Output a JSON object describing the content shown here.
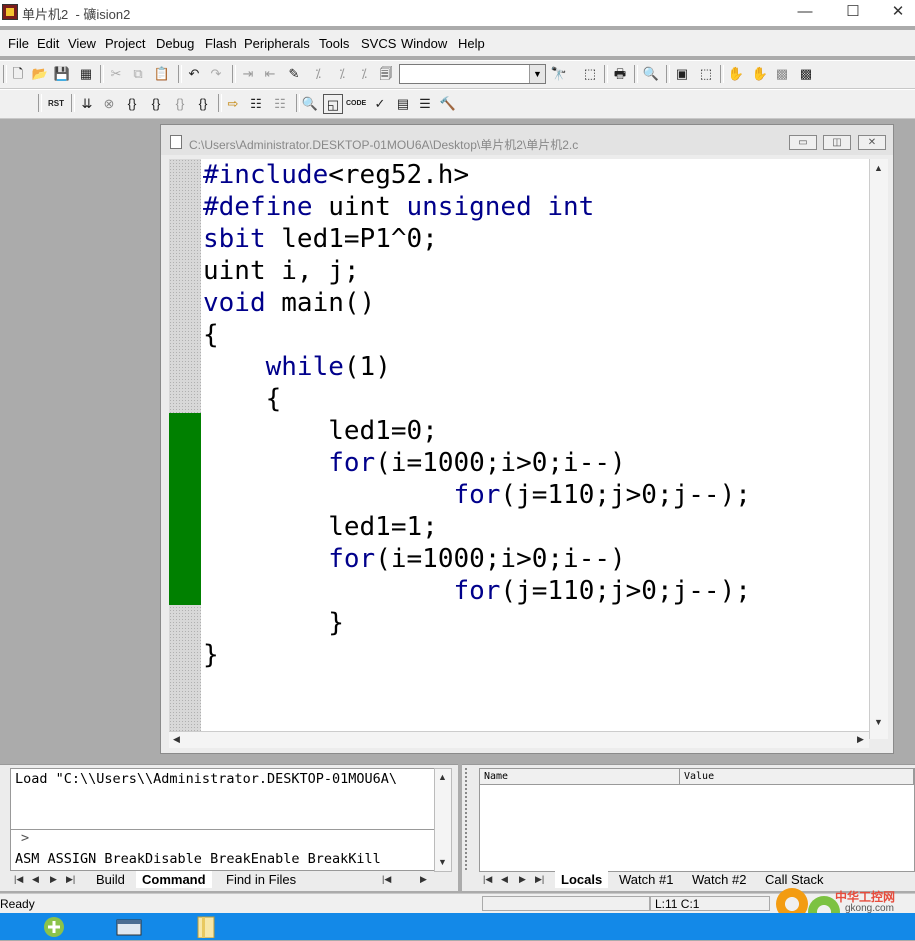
{
  "window": {
    "title": "单片机2  - 礦ision2",
    "minimize_glyph": "—",
    "maximize_glyph": "☐",
    "close_glyph": "✕"
  },
  "menu": [
    "File",
    "Edit",
    "View",
    "Project",
    "Debug",
    "Flash",
    "Peripherals",
    "Tools",
    "SVCS",
    "Window",
    "Help"
  ],
  "toolbar1": {
    "icons": [
      "new-file-icon",
      "open-folder-icon",
      "save-icon",
      "save-all-icon",
      "cut-icon",
      "copy-icon",
      "paste-icon",
      "undo-icon",
      "redo-icon",
      "indent-icon",
      "unindent-icon",
      "bookmark-icon",
      "next-bookmark-icon",
      "prev-bookmark-icon",
      "clear-bookmarks-icon",
      "find-combo",
      "find-icon",
      "find-in-files-icon",
      "print-icon",
      "debug-start-icon",
      "window-icon",
      "browse-icon",
      "hand-icon",
      "hand-stop-icon",
      "grid-icon",
      "options-icon"
    ],
    "glyphs": [
      "🗋",
      "📂",
      "💾",
      "▦",
      "✂",
      "⧉",
      "📋",
      "↶",
      "↷",
      "⇥",
      "⇤",
      "✎",
      "⁒",
      "⁒",
      "⁒",
      "",
      "🔭",
      "🗐",
      "🖶",
      "🔍",
      "▣",
      "⬚",
      "✋",
      "✋",
      "▩",
      "▩"
    ],
    "find_value": ""
  },
  "toolbar2": {
    "icons": [
      "reset-icon",
      "run-icon",
      "stop-icon",
      "step-into-icon",
      "step-over-icon",
      "step-out-icon",
      "run-to-cursor-icon",
      "show-next-icon",
      "enable-bp-icon",
      "disable-bp-icon",
      "disasm-icon",
      "watch-icon",
      "code-coverage-icon",
      "trace-icon",
      "memory-icon",
      "perf-icon",
      "toolbox-icon"
    ],
    "glyphs": [
      "RST",
      "⇊",
      "⊗",
      "{}",
      "{}",
      "{}",
      "{}",
      "⇨",
      "☷",
      "☷",
      "🔍",
      "◱",
      "CODE",
      "✓",
      "▤",
      "☰",
      "🔨"
    ]
  },
  "editor": {
    "title": "C:\\Users\\Administrator.DESKTOP-01MOU6A\\Desktop\\单片机2\\单片机2.c",
    "lines": [
      [
        {
          "t": "#include",
          "k": true
        },
        {
          "t": "<reg52.h>",
          "k": false
        }
      ],
      [
        {
          "t": "#define",
          "k": true
        },
        {
          "t": " uint ",
          "k": false
        },
        {
          "t": "unsigned int",
          "k": true
        }
      ],
      [
        {
          "t": "sbit",
          "k": true
        },
        {
          "t": " led1=P1^0;",
          "k": false
        }
      ],
      [
        {
          "t": "uint i, j;",
          "k": false
        }
      ],
      [
        {
          "t": "void",
          "k": true
        },
        {
          "t": " main()",
          "k": false
        }
      ],
      [
        {
          "t": "{",
          "k": false
        }
      ],
      [
        {
          "t": "    ",
          "k": false
        },
        {
          "t": "while",
          "k": true
        },
        {
          "t": "(1)",
          "k": false
        }
      ],
      [
        {
          "t": "    {",
          "k": false
        }
      ],
      [
        {
          "t": "        led1=0;",
          "k": false
        }
      ],
      [
        {
          "t": "        ",
          "k": false
        },
        {
          "t": "for",
          "k": true
        },
        {
          "t": "(i=1000;i>0;i--)",
          "k": false
        }
      ],
      [
        {
          "t": "                ",
          "k": false
        },
        {
          "t": "for",
          "k": true
        },
        {
          "t": "(j=110;j>0;j--);",
          "k": false
        }
      ],
      [
        {
          "t": "        led1=1;",
          "k": false
        }
      ],
      [
        {
          "t": "        ",
          "k": false
        },
        {
          "t": "for",
          "k": true
        },
        {
          "t": "(i=1000;i>0;i--)",
          "k": false
        }
      ],
      [
        {
          "t": "                ",
          "k": false
        },
        {
          "t": "for",
          "k": true
        },
        {
          "t": "(j=110;j>0;j--);",
          "k": false
        }
      ],
      [
        {
          "t": "        }",
          "k": false
        }
      ],
      [
        {
          "t": "}",
          "k": false
        }
      ]
    ]
  },
  "output": {
    "text": "Load \"C:\\\\Users\\\\Administrator.DESKTOP-01MOU6A\\",
    "prompt": ">",
    "commands": "ASM ASSIGN BreakDisable BreakEnable BreakKill",
    "tabs": [
      "Build",
      "Command",
      "Find in Files"
    ],
    "active_tab": "Command"
  },
  "watch": {
    "columns": [
      "Name",
      "Value"
    ],
    "tabs": [
      "Locals",
      "Watch #1",
      "Watch #2",
      "Call Stack"
    ],
    "active_tab": "Locals"
  },
  "status": {
    "text": "Ready",
    "position": "L:11 C:1"
  },
  "watermark": {
    "text": "中华工控网",
    "url": "gkong.com"
  },
  "colors": {
    "keyword": "#00008b",
    "breakpoint_bar": "#008000",
    "taskbar": "#1389e8"
  }
}
